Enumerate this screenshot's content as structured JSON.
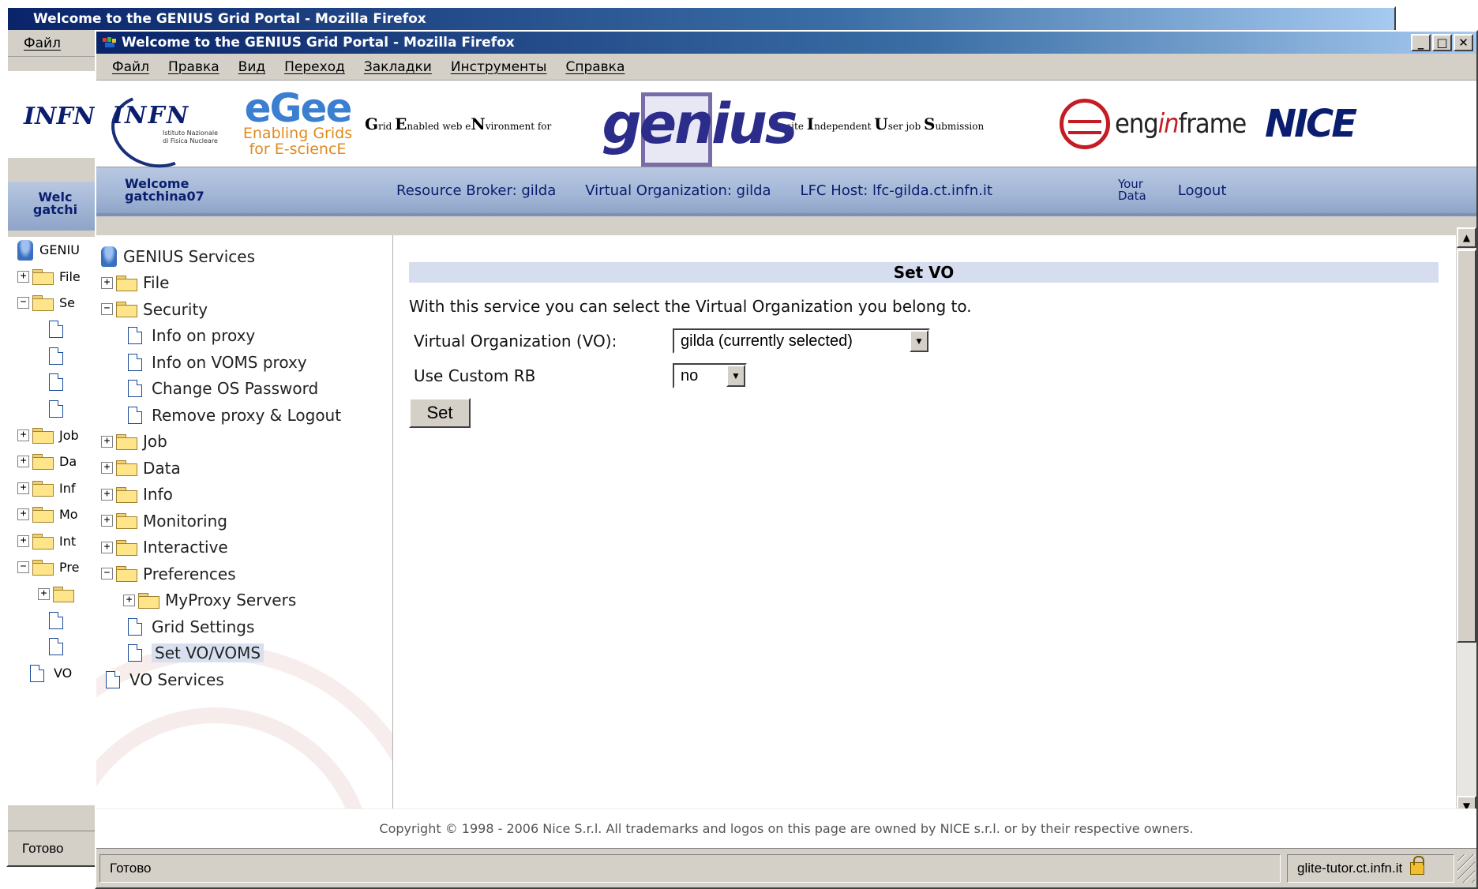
{
  "back_window": {
    "title": "Welcome to the GENIUS Grid Portal - Mozilla Firefox",
    "menu_first": "Файл",
    "welcome": "Welc",
    "user": "gatchi",
    "tree_items": [
      "GENIU",
      "File",
      "Se",
      "Job",
      "Da",
      "Inf",
      "Mo",
      "Int",
      "Pre",
      "VO"
    ],
    "status": "Готово"
  },
  "window": {
    "title": "Welcome to the GENIUS Grid Portal - Mozilla Firefox",
    "buttons": {
      "minimize": "_",
      "maximize": "□",
      "close": "✕"
    }
  },
  "menu": [
    "Файл",
    "Правка",
    "Вид",
    "Переход",
    "Закладки",
    "Инструменты",
    "Справка"
  ],
  "logos": {
    "infn": "INFN",
    "infn_sub1": "Istituto Nazionale",
    "infn_sub2": "di Fisica Nucleare",
    "egee": "eGee",
    "egee_line1": "Enabling Grids",
    "egee_line2": "for E-sciencE",
    "grid_env": [
      "G",
      "rid ",
      "E",
      "nabled web e",
      "N",
      "vironment for"
    ],
    "genius": "genius",
    "site_ind": [
      "site ",
      "I",
      "ndependent ",
      "U",
      "ser job ",
      "S",
      "ubmission"
    ],
    "enginframe_a": "eng",
    "enginframe_b": "in",
    "enginframe_c": "frame",
    "nice": "NICE"
  },
  "nav": {
    "welcome": "Welcome",
    "user": "gatchina07",
    "resource_broker": "Resource Broker: gilda",
    "virtual_org": "Virtual Organization: gilda",
    "lfc_host": "LFC Host: lfc-gilda.ct.infn.it",
    "your": "Your",
    "data": "Data",
    "logout": "Logout"
  },
  "tree": {
    "root": "GENIUS Services",
    "file": "File",
    "security": "Security",
    "info_proxy": "Info on proxy",
    "info_voms": "Info on VOMS proxy",
    "change_pw": "Change OS Password",
    "remove_proxy": "Remove proxy & Logout",
    "job": "Job",
    "data": "Data",
    "info": "Info",
    "monitoring": "Monitoring",
    "interactive": "Interactive",
    "preferences": "Preferences",
    "myproxy": "MyProxy Servers",
    "grid_settings": "Grid Settings",
    "set_vo": "Set VO/VOMS",
    "vo_services": "VO Services"
  },
  "main": {
    "header": "Set VO",
    "description": "With this service you can select the Virtual Organization you belong to.",
    "vo_label": "Virtual Organization (VO):",
    "vo_value": "gilda (currently selected)",
    "rb_label": "Use Custom RB",
    "rb_value": "no",
    "set_button": "Set"
  },
  "footer": "Copyright © 1998 - 2006 Nice S.r.l. All trademarks and logos on this page are owned by NICE s.r.l. or by their respective owners.",
  "status": {
    "text": "Готово",
    "host": "glite-tutor.ct.infn.it"
  }
}
